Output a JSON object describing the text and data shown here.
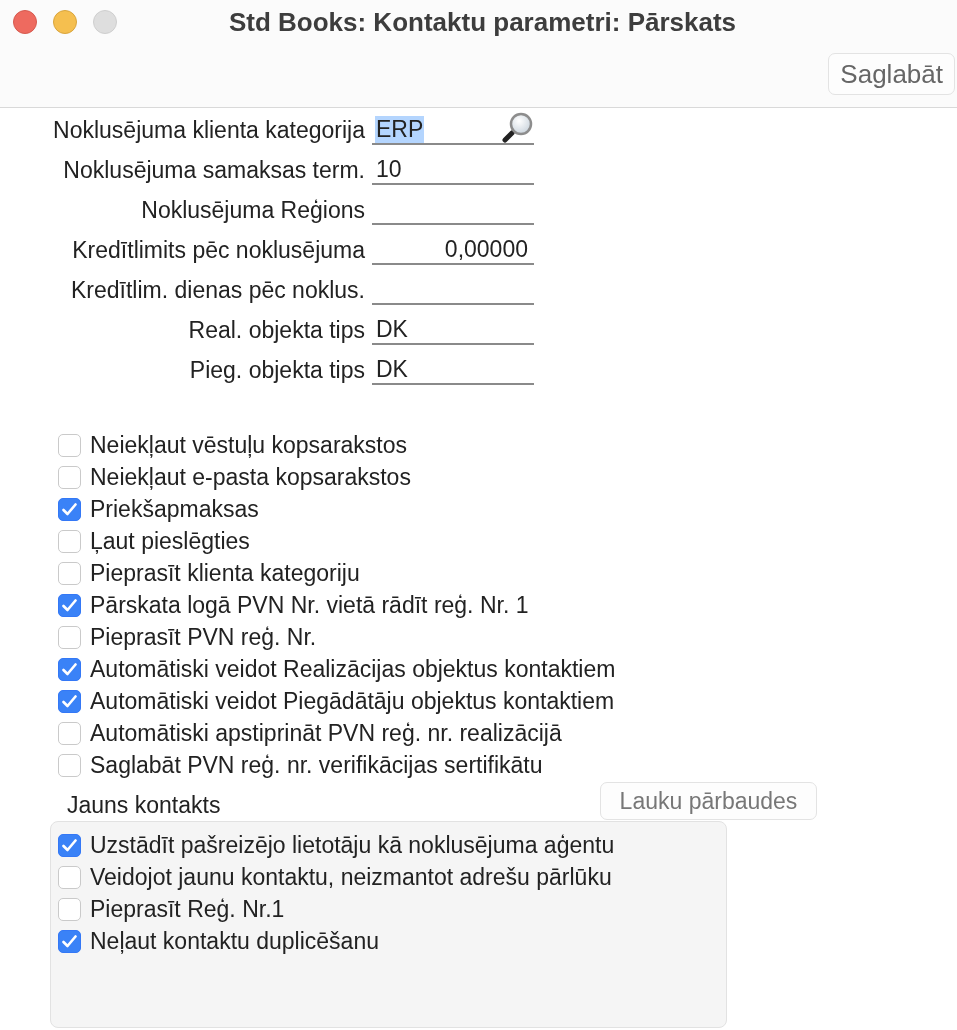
{
  "window": {
    "title": "Std Books: Kontaktu parametri: Pārskats"
  },
  "toolbar": {
    "save_button": "Saglabāt"
  },
  "fields": [
    {
      "label": "Noklusējuma klienta kategorija",
      "kind": "lookup",
      "value": "ERP",
      "value_selected": true
    },
    {
      "label": "Noklusējuma samaksas term.",
      "kind": "text",
      "value": "10",
      "value_selected": false
    },
    {
      "label": "Noklusējuma Reģions",
      "kind": "text"
    },
    {
      "label": "Kredītlimits pēc noklusējuma",
      "kind": "number",
      "value": "0,00000",
      "value_selected": false
    },
    {
      "label": "Kredītlim. dienas pēc noklus.",
      "kind": "text"
    },
    {
      "label": "Real. objekta tips",
      "kind": "text",
      "value": "DK",
      "value_selected": false
    },
    {
      "label": "Pieg. objekta tips",
      "kind": "text",
      "value": "DK",
      "value_selected": false
    }
  ],
  "checkboxes": [
    {
      "label": "Neiekļaut vēstuļu kopsarakstos",
      "checked": false
    },
    {
      "label": "Neiekļaut e-pasta kopsarakstos",
      "checked": false
    },
    {
      "label": "Priekšapmaksas",
      "checked": true
    },
    {
      "label": "Ļaut pieslēgties",
      "checked": false
    },
    {
      "label": "Pieprasīt klienta kategoriju",
      "checked": false
    },
    {
      "label": "Pārskata logā PVN Nr. vietā rādīt reģ. Nr. 1",
      "checked": true
    },
    {
      "label": "Pieprasīt PVN reģ. Nr.",
      "checked": false
    },
    {
      "label": "Automātiski veidot Realizācijas objektus kontaktiem",
      "checked": true
    },
    {
      "label": "Automātiski veidot Piegādātāju objektus kontaktiem",
      "checked": true
    },
    {
      "label": "Automātiski apstiprināt PVN reģ. nr. realizācijā",
      "checked": false
    },
    {
      "label": "Saglabāt PVN reģ. nr. verifikācijas sertifikātu",
      "checked": false
    }
  ],
  "field_checks_button": "Lauku pārbaudes",
  "new_contact": {
    "title": "Jauns kontakts",
    "checkboxes": [
      {
        "label": "Uzstādīt pašreizējo lietotāju kā noklusējuma aģentu",
        "checked": true
      },
      {
        "label": "Veidojot jaunu kontaktu, neizmantot adrešu pārlūku",
        "checked": false
      },
      {
        "label": "Pieprasīt Reģ. Nr.1",
        "checked": false
      },
      {
        "label": "Neļaut kontaktu duplicēšanu",
        "checked": true
      }
    ]
  }
}
